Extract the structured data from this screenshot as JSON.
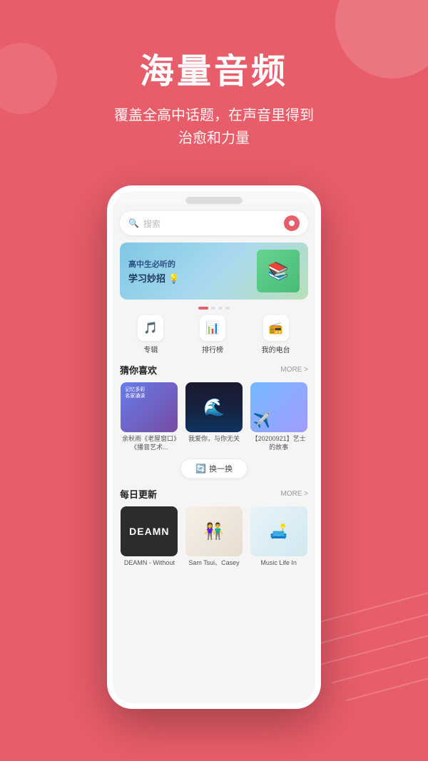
{
  "background": {
    "color": "#e85d6a"
  },
  "header": {
    "main_title": "海量音频",
    "sub_title_line1": "覆盖全高中话题，在声音里得到",
    "sub_title_line2": "治愈和力量"
  },
  "search": {
    "placeholder": "搜索"
  },
  "banner": {
    "line1": "高中生必听的",
    "line2": "学习妙招 💡"
  },
  "quick_nav": {
    "items": [
      {
        "label": "专辑",
        "icon": "🎵"
      },
      {
        "label": "排行榜",
        "icon": "📊"
      },
      {
        "label": "我的电台",
        "icon": "📻"
      }
    ]
  },
  "recommend_section": {
    "title": "猜你喜欢",
    "more": "MORE >",
    "items": [
      {
        "label": "余秋雨《老屋窗口》《播音艺术...",
        "cover_type": "1"
      },
      {
        "label": "我爱你，与你无关",
        "cover_type": "2"
      },
      {
        "label": "【20200921】艺士的故事",
        "cover_type": "3"
      }
    ],
    "refresh_label": "换一换"
  },
  "daily_section": {
    "title": "每日更新",
    "more": "MORE >",
    "items": [
      {
        "label": "DEAMN - Without",
        "cover_type": "dark"
      },
      {
        "label": "Sam Tsui、Casey",
        "cover_type": "warm"
      },
      {
        "label": "Music Life In",
        "cover_type": "light"
      }
    ]
  }
}
